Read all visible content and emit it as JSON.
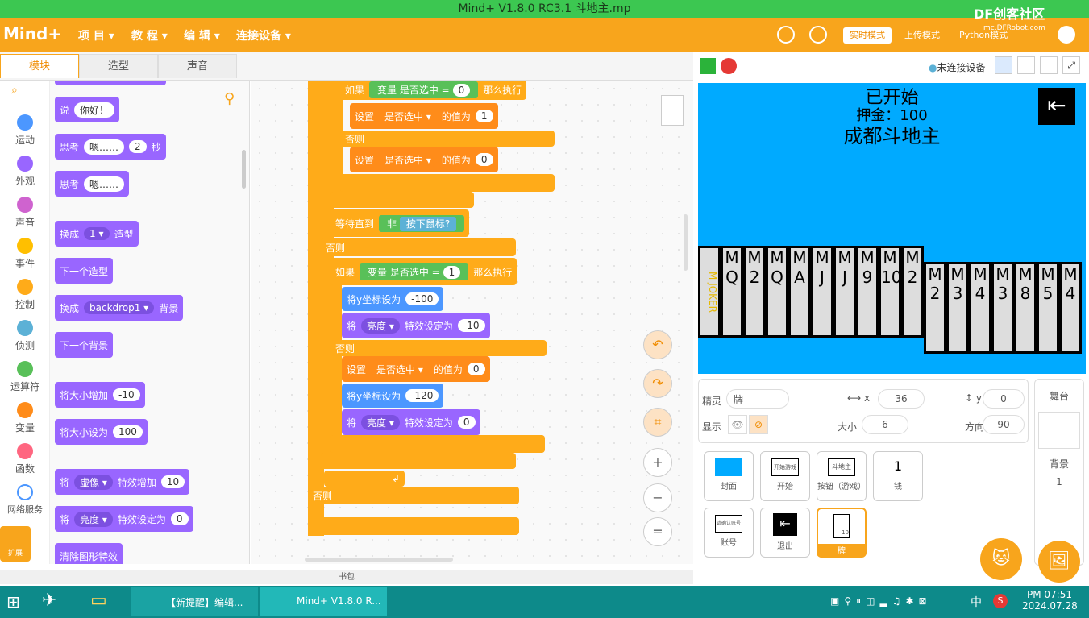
{
  "window": {
    "title": "Mind+ V1.8.0 RC3.1   斗地主.mp"
  },
  "watermark": {
    "brand": "DF创客社区",
    "url": "mc.DFRobot.com"
  },
  "app": {
    "logo": "Mind+"
  },
  "menu": [
    "项 目",
    "教 程",
    "编 辑",
    "连接设备"
  ],
  "modes": {
    "realtime": "实时模式",
    "upload": "上传模式",
    "python": "Python模式"
  },
  "tabs": {
    "blocks": "模块",
    "costumes": "造型",
    "sounds": "声音"
  },
  "categories": [
    {
      "label": "运动",
      "color": "#4c97ff"
    },
    {
      "label": "外观",
      "color": "#9966ff"
    },
    {
      "label": "声音",
      "color": "#cf63cf"
    },
    {
      "label": "事件",
      "color": "#ffbf00"
    },
    {
      "label": "控制",
      "color": "#ffab19"
    },
    {
      "label": "侦测",
      "color": "#5cb1d6"
    },
    {
      "label": "运算符",
      "color": "#59c059"
    },
    {
      "label": "变量",
      "color": "#ff8c1a"
    },
    {
      "label": "函数",
      "color": "#ff6680"
    },
    {
      "label": "网络服务",
      "color": "#4c97ff"
    }
  ],
  "ext_label": "扩展",
  "palette": {
    "say": {
      "label": "说",
      "value": "你好！"
    },
    "think_secs": {
      "label": "思考",
      "value": "嗯……",
      "secs": "2",
      "unit": "秒"
    },
    "think": {
      "label": "思考",
      "value": "嗯……"
    },
    "switch_costume": {
      "label": "换成",
      "value": "1",
      "suffix": "造型"
    },
    "next_costume": "下一个造型",
    "switch_backdrop": {
      "label": "换成",
      "value": "backdrop1",
      "suffix": "背景"
    },
    "next_backdrop": "下一个背景",
    "change_size": {
      "label": "将大小增加",
      "value": "-10"
    },
    "set_size": {
      "label": "将大小设为",
      "value": "100"
    },
    "change_effect": {
      "label": "将",
      "effect": "虚像",
      "mid": "特效增加",
      "value": "10"
    },
    "set_effect": {
      "label": "将",
      "effect": "亮度",
      "mid": "特效设定为",
      "value": "0"
    },
    "clear_effects": "清除图形特效"
  },
  "script": {
    "if1": {
      "if": "如果",
      "var": "变量 是否选中",
      "eq": "=",
      "val": "0",
      "then": "那么执行"
    },
    "set1": {
      "set": "设置",
      "var": "是否选中",
      "to": "的值为",
      "val": "1"
    },
    "else1": "否则",
    "set2": {
      "set": "设置",
      "var": "是否选中",
      "to": "的值为",
      "val": "0"
    },
    "wait": {
      "label": "等待直到",
      "not": "非",
      "sense": "按下鼠标?"
    },
    "else2": "否则",
    "if2": {
      "if": "如果",
      "var": "变量 是否选中",
      "eq": "=",
      "val": "1",
      "then": "那么执行"
    },
    "sety1": {
      "label": "将y坐标设为",
      "val": "-100"
    },
    "eff1": {
      "label": "将",
      "effect": "亮度",
      "mid": "特效设定为",
      "val": "-10"
    },
    "else3": "否则",
    "set3": {
      "set": "设置",
      "var": "是否选中",
      "to": "的值为",
      "val": "0"
    },
    "sety2": {
      "label": "将y坐标设为",
      "val": "-120"
    },
    "eff2": {
      "label": "将",
      "effect": "亮度",
      "mid": "特效设定为",
      "val": "0"
    },
    "else4": "否则"
  },
  "stage_header": {
    "connection": "未连接设备"
  },
  "stage": {
    "status": "已开始",
    "deposit": "押金：100",
    "game_title": "成都斗地主",
    "row1_cards": [
      "JOKER",
      "Q",
      "2",
      "Q",
      "A",
      "J",
      "J",
      "9",
      "10",
      "2"
    ],
    "row2_cards": [
      "2",
      "3",
      "4",
      "3",
      "8",
      "5",
      "4"
    ],
    "card_mark": "M"
  },
  "sprite_info": {
    "sprite_label": "精灵",
    "sprite_name": "牌",
    "x_label": "x",
    "x": "36",
    "y_label": "y",
    "y": "0",
    "show_label": "显示",
    "size_label": "大小",
    "size": "6",
    "dir_label": "方向",
    "dir": "90"
  },
  "sprites": [
    {
      "name": "封面"
    },
    {
      "name": "开始",
      "thumb": "开始游戏"
    },
    {
      "name": "按钮（游戏）",
      "thumb": "斗地主"
    },
    {
      "name": "钱",
      "thumb": "1"
    },
    {
      "name": "账号",
      "thumb": "请确认账号"
    },
    {
      "name": "退出"
    },
    {
      "name": "牌",
      "thumb": "10"
    }
  ],
  "stage_panel": {
    "title": "舞台",
    "bg_label": "背景",
    "bg_count": "1"
  },
  "bookbag": "书包",
  "taskbar": {
    "items": [
      {
        "label": "【新提醒】编辑..."
      },
      {
        "label": "Mind+ V1.8.0 R..."
      }
    ],
    "time": "PM 07:51",
    "date": "2024.07.28",
    "ime": "中"
  }
}
